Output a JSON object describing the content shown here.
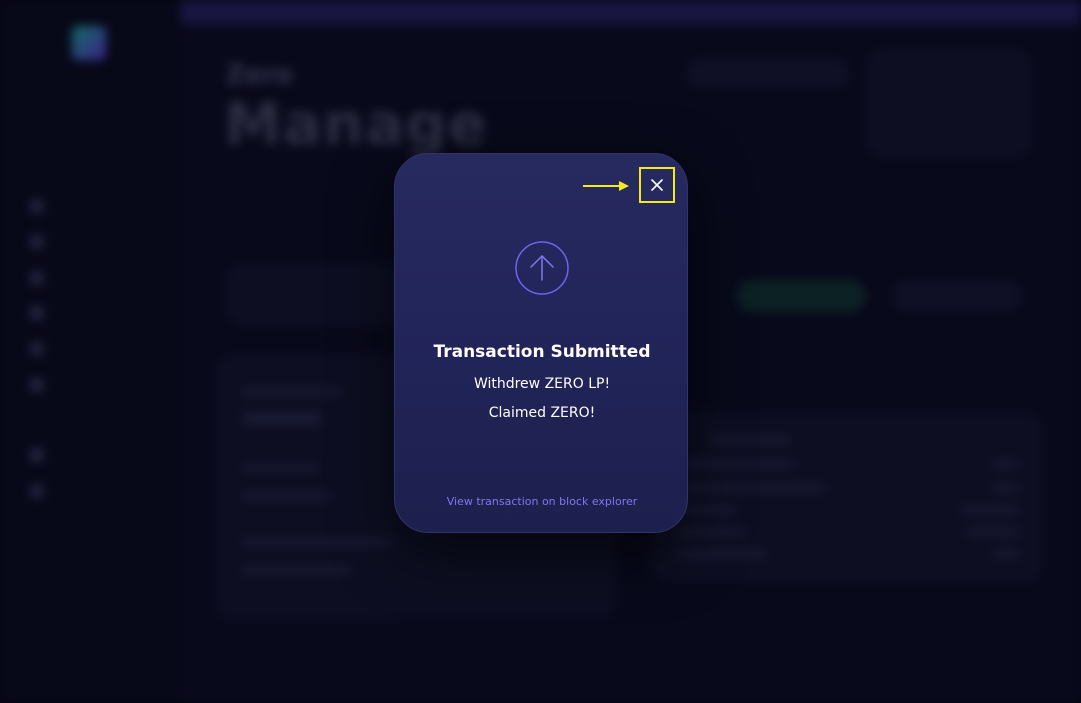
{
  "background": {
    "header_eyebrow": "Zero",
    "page_title": "Manage",
    "sidebar_items": [
      "",
      "",
      "",
      "",
      "",
      "",
      "",
      ""
    ]
  },
  "modal": {
    "title": "Transaction Submitted",
    "lines": [
      "Withdrew ZERO LP!",
      "Claimed ZERO!"
    ],
    "link_text": "View transaction on block explorer",
    "close_icon": "close-icon",
    "status_icon": "arrow-up-circle-icon",
    "highlight_color": "#f2ea1a",
    "accent_color": "#7e78f0"
  }
}
